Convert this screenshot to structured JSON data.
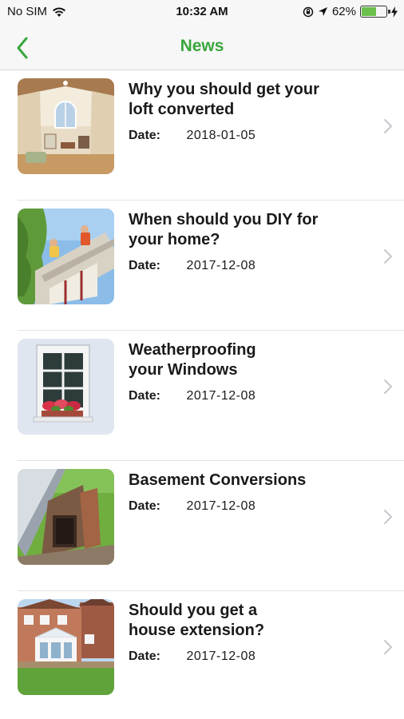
{
  "status": {
    "carrier": "No SIM",
    "time": "10:32 AM",
    "battery_percent": "62%",
    "battery_level": 0.62
  },
  "nav": {
    "title": "News",
    "accent_color": "#3aa63d"
  },
  "news": [
    {
      "title_line1": "Why you should get your",
      "title_line2": "loft converted",
      "date_label": "Date:",
      "date": "2018-01-05"
    },
    {
      "title_line1": "When should you DIY for",
      "title_line2": "your home?",
      "date_label": "Date:",
      "date": "2017-12-08"
    },
    {
      "title_line1": "Weatherproofing",
      "title_line2": "your Windows",
      "date_label": "Date:",
      "date": "2017-12-08"
    },
    {
      "title_line1": "Basement Conversions",
      "title_line2": "",
      "date_label": "Date:",
      "date": "2017-12-08"
    },
    {
      "title_line1": "Should you get a",
      "title_line2": "house extension?",
      "date_label": "Date:",
      "date": "2017-12-08"
    }
  ]
}
